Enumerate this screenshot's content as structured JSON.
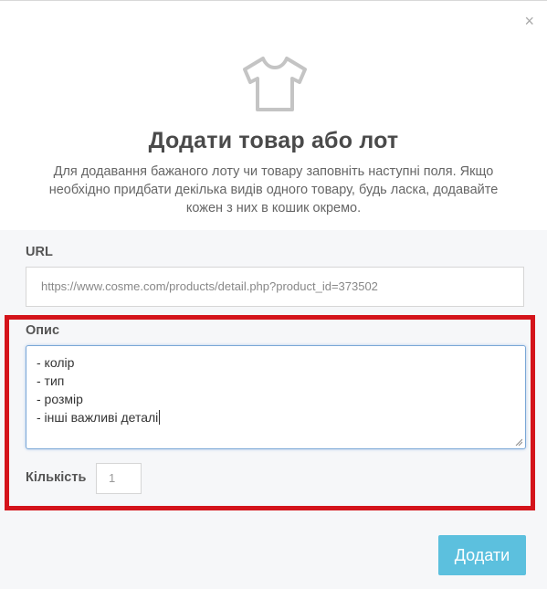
{
  "modal": {
    "close_icon": "×",
    "product_icon": "tshirt-icon",
    "title": "Додати товар або лот",
    "description_lines": [
      "Для додавання бажаного лоту чи товару заповніть наступні поля. Якщо",
      "необхідно придбати декілька видів одного товару, будь ласка, додавайте",
      "кожен з них в кошик окремо."
    ]
  },
  "form": {
    "url": {
      "label": "URL",
      "value": "https://www.cosme.com/products/detail.php?product_id=373502"
    },
    "description": {
      "label": "Опис",
      "lines": [
        "- колір",
        "- тип",
        "- розмір",
        "- інші важливі деталі"
      ]
    },
    "quantity": {
      "label": "Кількість",
      "placeholder": "1"
    },
    "submit_label": "Додати"
  },
  "colors": {
    "highlight_border": "#d4141b",
    "submit_button": "#5cc0de",
    "form_background": "#f6f7f9",
    "textarea_focus": "#7aa7d6"
  }
}
